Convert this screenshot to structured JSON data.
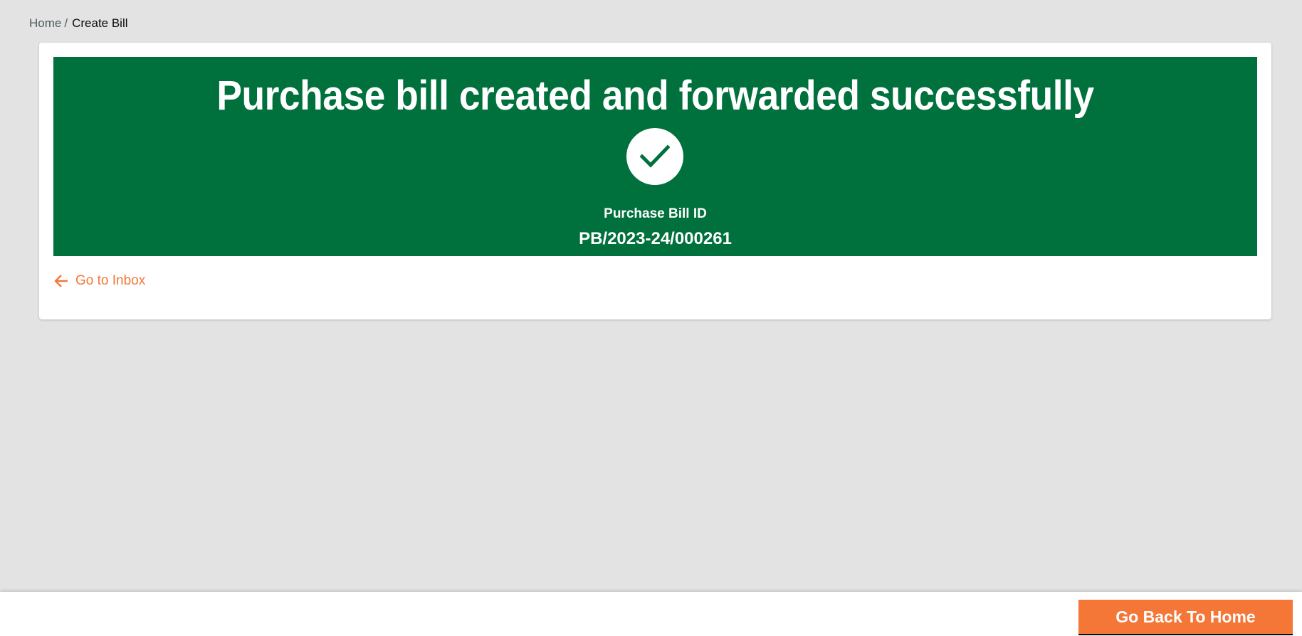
{
  "breadcrumb": {
    "home_label": "Home",
    "separator": "/",
    "current_label": "Create Bill"
  },
  "banner": {
    "title": "Purchase bill created and forwarded successfully",
    "icon": "check-icon",
    "bill_id_label": "Purchase Bill ID",
    "bill_id_value": "PB/2023-24/000261"
  },
  "links": {
    "inbox_label": "Go to Inbox",
    "inbox_icon": "arrow-left-icon"
  },
  "action_bar": {
    "home_button_label": "Go Back To Home"
  },
  "colors": {
    "success_green": "#00703c",
    "accent_orange": "#f47738",
    "background": "#e3e3e3"
  }
}
